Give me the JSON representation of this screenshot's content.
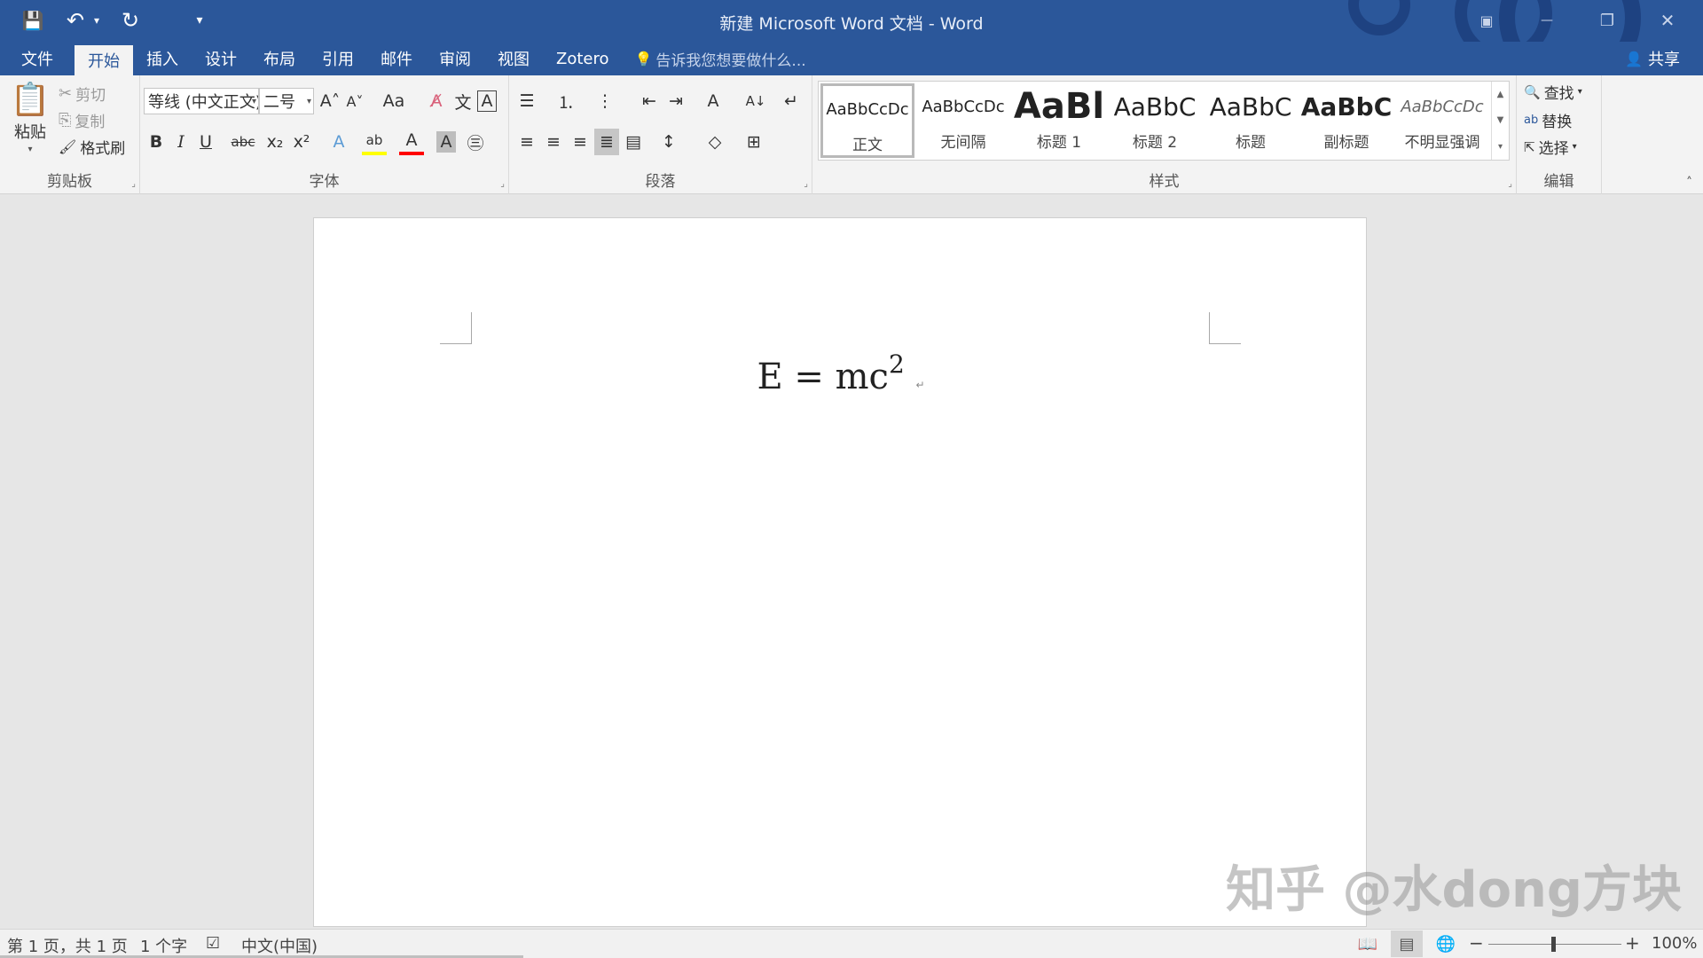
{
  "titlebar": {
    "title": "新建 Microsoft Word 文档 - Word",
    "qat": {
      "save_icon": "💾",
      "undo_icon": "↶",
      "undo_dd": "▾",
      "redo_icon": "↻",
      "customize_icon": "▾"
    },
    "controls": {
      "ribbon_display": "▣",
      "minimize": "—",
      "restore": "❐",
      "close": "✕"
    }
  },
  "tabs": [
    {
      "label": "文件"
    },
    {
      "label": "开始"
    },
    {
      "label": "插入"
    },
    {
      "label": "设计"
    },
    {
      "label": "布局"
    },
    {
      "label": "引用"
    },
    {
      "label": "邮件"
    },
    {
      "label": "审阅"
    },
    {
      "label": "视图"
    },
    {
      "label": "Zotero"
    }
  ],
  "tellme": {
    "icon": "💡",
    "placeholder": "告诉我您想要做什么..."
  },
  "share": {
    "icon": "👤",
    "label": "共享"
  },
  "clipboard": {
    "group_label": "剪贴板",
    "paste_label": "粘贴",
    "paste_icon": "📋",
    "cut_label": "剪切",
    "cut_icon": "✂",
    "copy_label": "复制",
    "copy_icon": "⎘",
    "painter_label": "格式刷",
    "painter_icon": "🖌"
  },
  "font": {
    "group_label": "字体",
    "family": "等线 (中文正文)",
    "size": "二号",
    "grow": "A˄",
    "shrink": "A˅",
    "change_case": "Aa",
    "clear_format": "A̸",
    "phonetic": "文",
    "char_border": "A",
    "bold": "B",
    "italic": "I",
    "underline": "U",
    "strike": "abc",
    "subscript": "x₂",
    "superscript": "x²",
    "text_effects": "A",
    "highlight": "ab",
    "font_color": "A",
    "char_shading": "A",
    "enclose": "㊂"
  },
  "paragraph": {
    "group_label": "段落",
    "bullets": "☰",
    "numbering": "⒈",
    "multilevel": "⋮",
    "dec_indent": "⇤",
    "inc_indent": "⇥",
    "chinese_layout": "A",
    "sort": "A↓",
    "show_marks": "↵",
    "align_left": "≡",
    "center": "≡",
    "align_right": "≡",
    "justify": "≣",
    "distributed": "▤",
    "line_spacing": "↕",
    "shading": "◇",
    "borders": "⊞"
  },
  "styles": {
    "group_label": "样式",
    "items": [
      {
        "preview": "AaBbCcDc",
        "name": "正文"
      },
      {
        "preview": "AaBbCcDc",
        "name": "无间隔"
      },
      {
        "preview": "AaBl",
        "name": "标题 1"
      },
      {
        "preview": "AaBbC",
        "name": "标题 2"
      },
      {
        "preview": "AaBbC",
        "name": "标题"
      },
      {
        "preview": "AaBbC",
        "name": "副标题"
      },
      {
        "preview": "AaBbCcDc",
        "name": "不明显强调"
      }
    ],
    "scroll_up": "▲",
    "scroll_down": "▼",
    "more": "▾"
  },
  "editing": {
    "group_label": "编辑",
    "find_label": "查找",
    "find_icon": "🔍",
    "replace_label": "替换",
    "replace_icon": "ab",
    "select_label": "选择",
    "select_icon": "⇱"
  },
  "ribbon_collapse_icon": "˄",
  "launcher_icon": "⌟",
  "dropdown_icon": "▾",
  "document": {
    "equation_base": "E = mc",
    "equation_exp": "2",
    "para_mark": "↵"
  },
  "watermark": "知乎 @水dong方块",
  "status": {
    "page": "第 1 页，共 1 页",
    "words": "1 个字",
    "proof_icon": "☑",
    "language": "中文(中国)",
    "read_icon": "📖",
    "print_icon": "▤",
    "web_icon": "🌐",
    "zoom_out": "−",
    "zoom_in": "+",
    "zoom": "100%",
    "zoom_fraction": 0.5
  },
  "colors": {
    "brand": "#2b579a",
    "highlight": "#ffff00",
    "font_color": "#ff0000"
  }
}
